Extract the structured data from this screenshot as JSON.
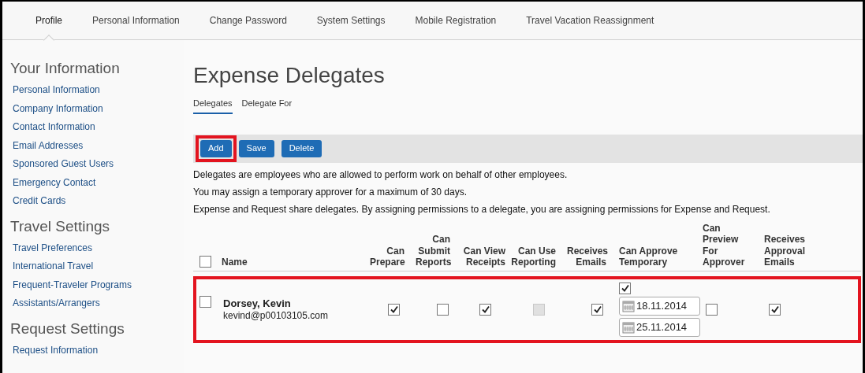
{
  "tabs": [
    {
      "label": "Profile",
      "selected": true
    },
    {
      "label": "Personal Information",
      "selected": false
    },
    {
      "label": "Change Password",
      "selected": false
    },
    {
      "label": "System Settings",
      "selected": false
    },
    {
      "label": "Mobile Registration",
      "selected": false
    },
    {
      "label": "Travel Vacation Reassignment",
      "selected": false
    }
  ],
  "sidebar": {
    "sections": [
      {
        "title": "Your Information",
        "items": [
          "Personal Information",
          "Company Information",
          "Contact Information",
          "Email Addresses",
          "Sponsored Guest Users",
          "Emergency Contact",
          "Credit Cards"
        ]
      },
      {
        "title": "Travel Settings",
        "items": [
          "Travel Preferences",
          "International Travel",
          "Frequent-Traveler Programs",
          "Assistants/Arrangers"
        ]
      },
      {
        "title": "Request Settings",
        "items": [
          "Request Information"
        ]
      }
    ]
  },
  "page_title": "Expense Delegates",
  "subtabs": [
    {
      "label": "Delegates",
      "selected": true
    },
    {
      "label": "Delegate For",
      "selected": false
    }
  ],
  "toolbar": [
    {
      "label": "Add",
      "highlighted": true
    },
    {
      "label": "Save",
      "highlighted": false
    },
    {
      "label": "Delete",
      "highlighted": false
    }
  ],
  "info": [
    "Delegates are employees who are allowed to perform work on behalf of other employees.",
    "You may assign a temporary approver for a maximum of 30 days.",
    "Expense and Request share delegates. By assigning permissions to a delegate, you are assigning permissions for Expense and Request."
  ],
  "table": {
    "select_all_checked": false,
    "columns": [
      "Name",
      "Can Prepare",
      "Can Submit Reports",
      "Can View Receipts",
      "Can Use Reporting",
      "Receives Emails",
      "Can Approve Temporary",
      "Can Preview For Approver",
      "Receives Approval Emails"
    ],
    "rows": [
      {
        "selected": false,
        "highlighted": true,
        "name": "Dorsey, Kevin",
        "email": "kevind@p00103105.com",
        "permissions": [
          {
            "checked": true,
            "disabled": false
          },
          {
            "checked": false,
            "disabled": false
          },
          {
            "checked": true,
            "disabled": false
          },
          {
            "checked": false,
            "disabled": true
          },
          {
            "checked": true,
            "disabled": false
          },
          {
            "checked": true,
            "disabled": false,
            "dates": [
              "18.11.2014",
              "25.11.2014"
            ]
          },
          {
            "checked": false,
            "disabled": false
          },
          {
            "checked": true,
            "disabled": false
          }
        ]
      }
    ]
  }
}
